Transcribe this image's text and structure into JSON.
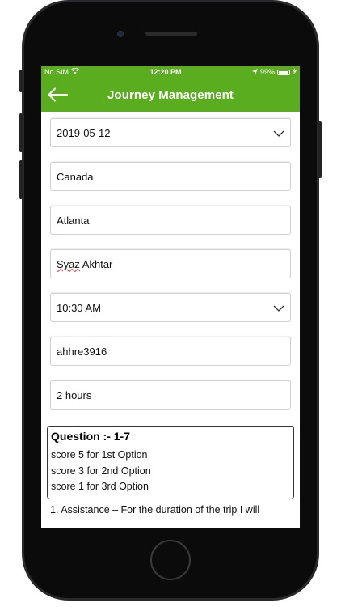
{
  "status_bar": {
    "carrier": "No SIM",
    "time": "12:20 PM",
    "battery_percent": "99%"
  },
  "nav": {
    "title": "Journey Management"
  },
  "form": {
    "date": "2019-05-12",
    "country": "Canada",
    "city": "Atlanta",
    "name_first": "Syaz",
    "name_last": " Akhtar",
    "time": "10:30 AM",
    "code": "ahhre3916",
    "duration": "2 hours"
  },
  "question": {
    "title": "Question :-  1-7",
    "lines": [
      "score 5 for 1st Option",
      "score 3 for 2nd Option",
      "score 1 for 3rd Option"
    ],
    "item1": "1. Assistance – For the duration of the trip I will"
  },
  "colors": {
    "accent": "#5aad1e",
    "frame": "#2a2a2c"
  }
}
